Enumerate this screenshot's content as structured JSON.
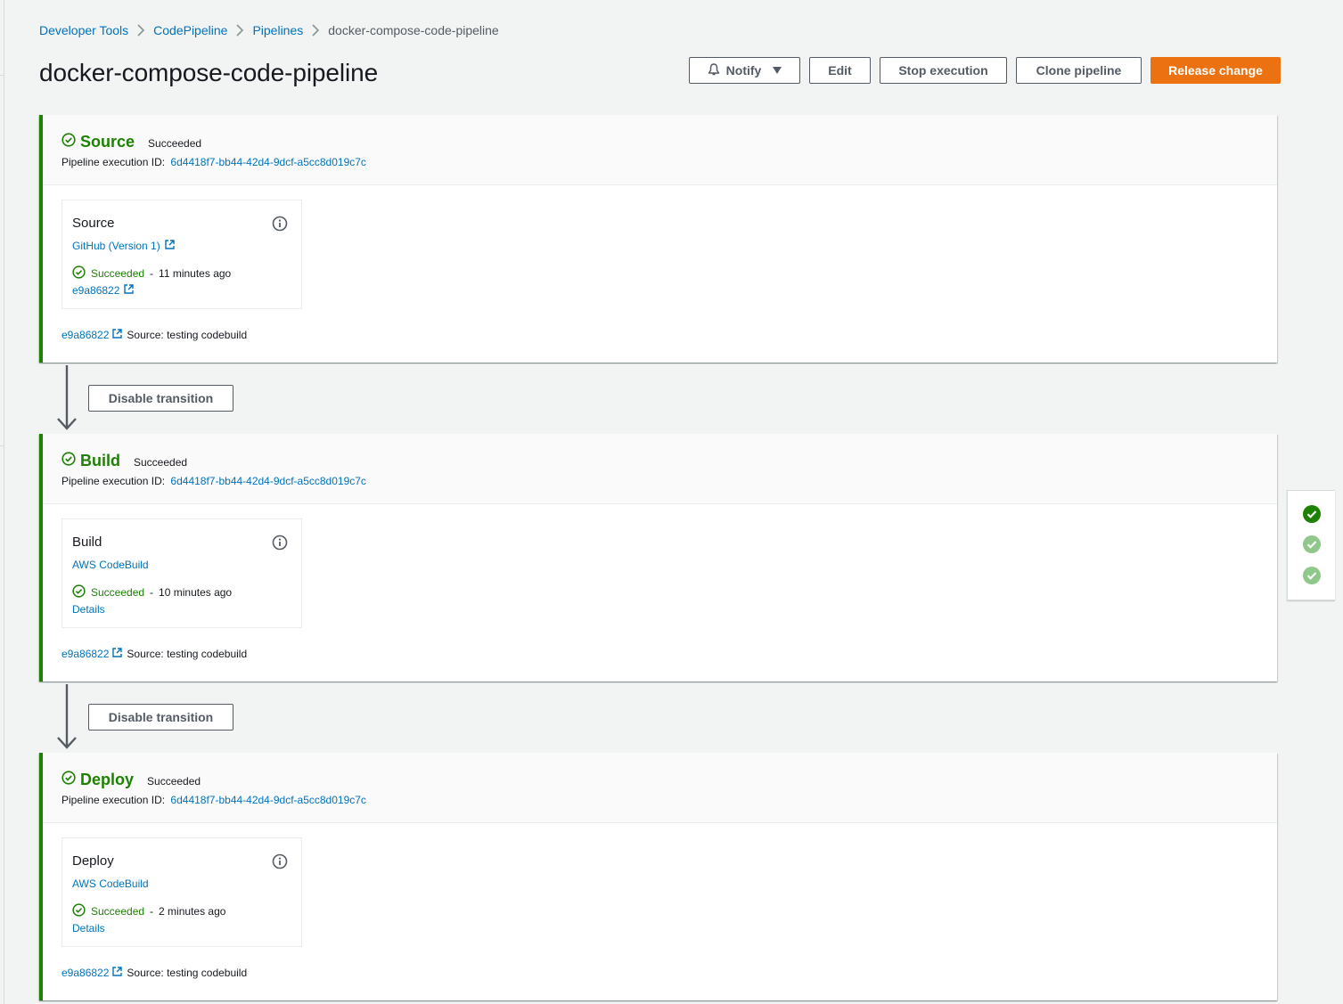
{
  "breadcrumb": [
    {
      "label": "Developer Tools",
      "current": false
    },
    {
      "label": "CodePipeline",
      "current": false
    },
    {
      "label": "Pipelines",
      "current": false
    },
    {
      "label": "docker-compose-code-pipeline",
      "current": true
    }
  ],
  "page_title": "docker-compose-code-pipeline",
  "toolbar": {
    "notify_label": "Notify",
    "edit_label": "Edit",
    "stop_label": "Stop execution",
    "clone_label": "Clone pipeline",
    "release_label": "Release change"
  },
  "colors": {
    "success": "#1d8102",
    "link": "#0073bb",
    "primary": "#ec7211"
  },
  "exec_label": "Pipeline execution ID:",
  "transition_label": "Disable transition",
  "stages": [
    {
      "name": "Source",
      "status": "Succeeded",
      "execution_id": "6d4418f7-bb44-42d4-9dcf-a5cc8d019c7c",
      "action": {
        "name": "Source",
        "provider": "GitHub (Version 1)",
        "status": "Succeeded",
        "time": "11 minutes ago",
        "link": "e9a86822"
      },
      "revision": {
        "id": "e9a86822",
        "message": "Source: testing codebuild"
      }
    },
    {
      "name": "Build",
      "status": "Succeeded",
      "execution_id": "6d4418f7-bb44-42d4-9dcf-a5cc8d019c7c",
      "action": {
        "name": "Build",
        "provider": "AWS CodeBuild",
        "status": "Succeeded",
        "time": "10 minutes ago",
        "link": "Details"
      },
      "revision": {
        "id": "e9a86822",
        "message": "Source: testing codebuild"
      }
    },
    {
      "name": "Deploy",
      "status": "Succeeded",
      "execution_id": "6d4418f7-bb44-42d4-9dcf-a5cc8d019c7c",
      "action": {
        "name": "Deploy",
        "provider": "AWS CodeBuild",
        "status": "Succeeded",
        "time": "2 minutes ago",
        "link": "Details"
      },
      "revision": {
        "id": "e9a86822",
        "message": "Source: testing codebuild"
      }
    }
  ],
  "side_panel": [
    "check-circle-filled-icon",
    "check-circle-light-icon",
    "check-circle-light-icon"
  ]
}
